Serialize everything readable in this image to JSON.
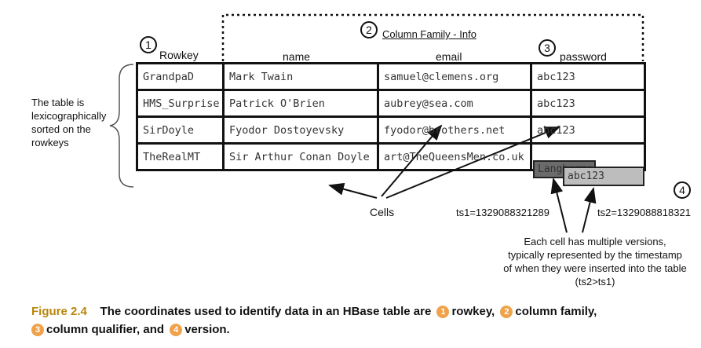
{
  "diagram": {
    "markers": [
      "1",
      "2",
      "3",
      "4"
    ],
    "column_family_label": "Column Family - Info",
    "headers": {
      "rowkey": "Rowkey",
      "name": "name",
      "email": "email",
      "password": "password"
    },
    "rows": [
      {
        "rowkey": "GrandpaD",
        "name": "Mark Twain",
        "email": "samuel@clemens.org",
        "password": "abc123"
      },
      {
        "rowkey": "HMS_Surprise",
        "name": "Patrick O'Brien",
        "email": "aubrey@sea.com",
        "password": "abc123"
      },
      {
        "rowkey": "SirDoyle",
        "name": "Fyodor Dostoyevsky",
        "email": "fyodor@brothers.net",
        "password": "abc123"
      },
      {
        "rowkey": "TheRealMT",
        "name": "Sir Arthur Conan Doyle",
        "email": "art@TheQueensMen.co.uk",
        "password_v1": "Langhorne",
        "password_v2": "abc123"
      }
    ],
    "sorted_note": [
      "The table is",
      "lexicographically",
      "sorted on the",
      "rowkeys"
    ],
    "cells_label": "Cells",
    "ts1": "ts1=1329088321289",
    "ts2": "ts2=1329088818321",
    "versions_note": [
      "Each cell has multiple versions,",
      "typically represented by the timestamp",
      "of when they were inserted into the table",
      "(ts2>ts1)"
    ],
    "colors": {
      "version_old": "#6b6b6b",
      "version_new": "#bdbdbd",
      "caption_label": "#b8860b",
      "marker_fill": "#f0a24a"
    }
  },
  "caption": {
    "label": "Figure 2.4",
    "text_a": "The coordinates used to identify data in an HBase table are",
    "m1": "1",
    "t1": "rowkey,",
    "m2": "2",
    "t2": "column family,",
    "m3": "3",
    "t3": "column qualifier, and",
    "m4": "4",
    "t4": "version."
  }
}
